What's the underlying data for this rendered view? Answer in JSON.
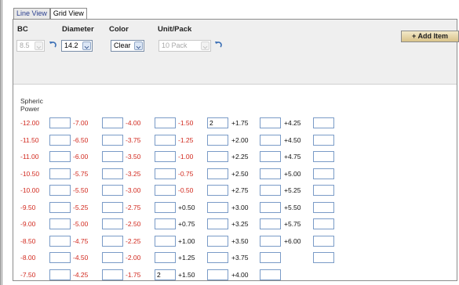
{
  "tabs": [
    {
      "label": "Line View",
      "active": false
    },
    {
      "label": "Grid View",
      "active": true
    }
  ],
  "options": {
    "bc": {
      "header": "BC",
      "value": "8.5",
      "disabled": true
    },
    "diameter": {
      "header": "Diameter",
      "value": "14.2",
      "disabled": false
    },
    "color": {
      "header": "Color",
      "value": "Clear",
      "disabled": false
    },
    "unit_pack": {
      "header": "Unit/Pack",
      "value": "10 Pack",
      "disabled": true
    }
  },
  "add_button_label": "+ Add Item",
  "grid_header": [
    "Spheric",
    "Power"
  ],
  "columns": [
    {
      "type": "neg",
      "powers": [
        "-12.00",
        "-11.50",
        "-11.00",
        "-10.50",
        "-10.00",
        "-9.50",
        "-9.00",
        "-8.50",
        "-8.00",
        "-7.50"
      ],
      "quantities": [
        "",
        "",
        "",
        "",
        "",
        "",
        "",
        "",
        "",
        ""
      ]
    },
    {
      "type": "neg",
      "powers": [
        "-7.00",
        "-6.50",
        "-6.00",
        "-5.75",
        "-5.50",
        "-5.25",
        "-5.00",
        "-4.75",
        "-4.50",
        "-4.25"
      ],
      "quantities": [
        "",
        "",
        "",
        "",
        "",
        "",
        "",
        "",
        "",
        ""
      ]
    },
    {
      "type": "neg",
      "powers": [
        "-4.00",
        "-3.75",
        "-3.50",
        "-3.25",
        "-3.00",
        "-2.75",
        "-2.50",
        "-2.25",
        "-2.00",
        "-1.75"
      ],
      "quantities": [
        "",
        "",
        "",
        "",
        "",
        "",
        "",
        "",
        "",
        "2"
      ]
    },
    {
      "type": "mixed",
      "powers": [
        "-1.50",
        "-1.25",
        "-1.00",
        "-0.75",
        "-0.50",
        "+0.50",
        "+0.75",
        "+1.00",
        "+1.25",
        "+1.50"
      ],
      "quantities": [
        "2",
        "",
        "",
        "",
        "",
        "",
        "",
        "",
        "",
        ""
      ]
    },
    {
      "type": "pos",
      "powers": [
        "+1.75",
        "+2.00",
        "+2.25",
        "+2.50",
        "+2.75",
        "+3.00",
        "+3.25",
        "+3.50",
        "+3.75",
        "+4.00"
      ],
      "quantities": [
        "",
        "",
        "",
        "",
        "",
        "",
        "",
        "",
        "",
        ""
      ]
    },
    {
      "type": "pos",
      "powers": [
        "+4.25",
        "+4.50",
        "+4.75",
        "+5.00",
        "+5.25",
        "+5.50",
        "+5.75",
        "+6.00"
      ],
      "quantities": [
        "",
        "",
        "",
        "",
        "",
        "",
        "",
        "",
        ""
      ]
    }
  ],
  "colors": {
    "negative": "#d22a1f",
    "positive": "#111111",
    "button_top": "#f3e9c9",
    "button_bottom": "#d9c38a",
    "input_border": "#7a9bc7"
  }
}
